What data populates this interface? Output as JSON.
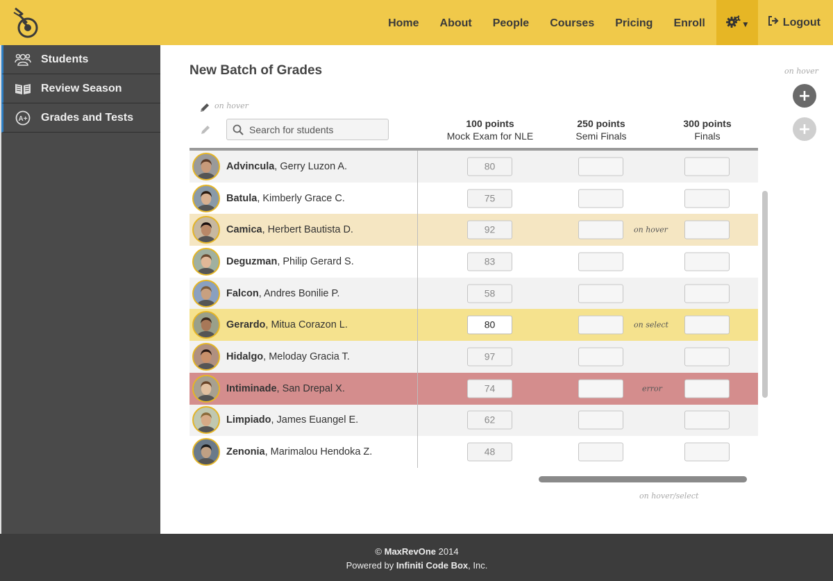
{
  "nav": {
    "items": [
      "Home",
      "About",
      "People",
      "Courses",
      "Pricing",
      "Enroll"
    ],
    "logout": "Logout",
    "icons": {
      "settings": "gear-icon",
      "dropdown": "caret-down-icon",
      "logout": "sign-out-icon"
    }
  },
  "sidebar": {
    "items": [
      {
        "label": "Students",
        "icon": "users-icon"
      },
      {
        "label": "Review Season",
        "icon": "book-icon"
      },
      {
        "label": "Grades and Tests",
        "icon": "grade-icon"
      }
    ]
  },
  "page": {
    "title": "New Batch of Grades",
    "hint_edit": "on hover",
    "hint_fab": "on hover",
    "hint_scroll": "on hover/select",
    "search_placeholder": "Search for students"
  },
  "columns": [
    {
      "points": "100 points",
      "name": "Mock Exam for NLE"
    },
    {
      "points": "250 points",
      "name": "Semi Finals"
    },
    {
      "points": "300 points",
      "name": "Finals"
    }
  ],
  "students": [
    {
      "last": "Advincula",
      "first": ", Gerry Luzon A.",
      "grade": "80",
      "state": "normal",
      "note": ""
    },
    {
      "last": "Batula",
      "first": ", Kimberly Grace C.",
      "grade": "75",
      "state": "normal",
      "note": ""
    },
    {
      "last": "Camica",
      "first": ", Herbert Bautista D.",
      "grade": "92",
      "state": "hover",
      "note": "on hover"
    },
    {
      "last": "Deguzman",
      "first": ", Philip Gerard S.",
      "grade": "83",
      "state": "normal",
      "note": ""
    },
    {
      "last": "Falcon",
      "first": ", Andres Bonilie P.",
      "grade": "58",
      "state": "normal",
      "note": ""
    },
    {
      "last": "Gerardo",
      "first": ", Mitua Corazon L.",
      "grade": "80",
      "state": "select",
      "note": "on select"
    },
    {
      "last": "Hidalgo",
      "first": ", Meloday Gracia T.",
      "grade": "97",
      "state": "normal",
      "note": ""
    },
    {
      "last": "Intiminade",
      "first": ", San Drepal X.",
      "grade": "74",
      "state": "error",
      "note": "error"
    },
    {
      "last": "Limpiado",
      "first": ", James Euangel E.",
      "grade": "62",
      "state": "normal",
      "note": ""
    },
    {
      "last": "Zenonia",
      "first": ", Marimalou Hendoka Z.",
      "grade": "48",
      "state": "normal",
      "note": ""
    }
  ],
  "footer": {
    "copyright_prefix": "© ",
    "brand": "MaxRevOne",
    "year": " 2014",
    "powered_prefix": "Powered by ",
    "company": "Infiniti Code Box",
    "company_suffix": ", Inc."
  },
  "colors": {
    "header": "#f0c94a",
    "accent_dark": "#e6b625",
    "sidebar": "#4a4a4a",
    "footer": "#3c3c3c",
    "row_hover": "#f5e6c2",
    "row_select": "#f5e28e",
    "row_error": "#d48d8d"
  }
}
